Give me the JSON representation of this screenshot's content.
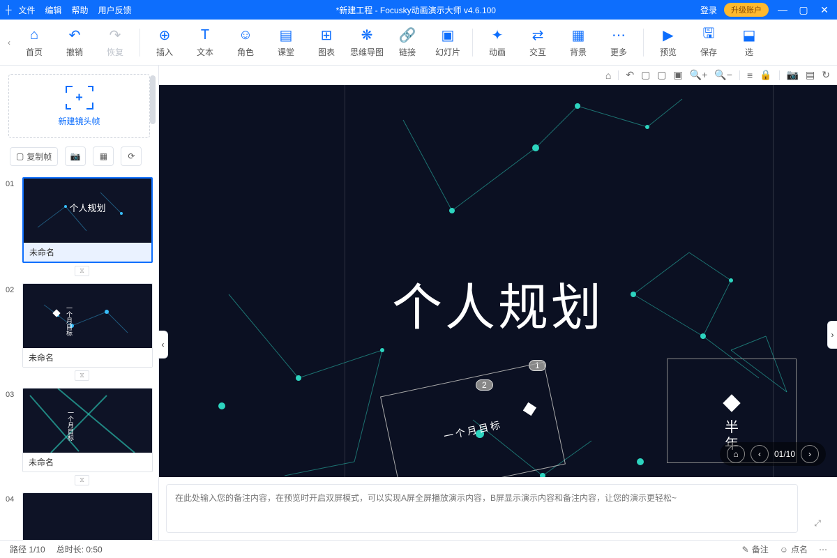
{
  "titlebar": {
    "menus": [
      "文件",
      "编辑",
      "帮助",
      "用户反馈"
    ],
    "title": "*新建工程 - Focusky动画演示大师  v4.6.100",
    "login": "登录",
    "upgrade": "升级账户"
  },
  "toolbar": {
    "items": [
      {
        "icon": "⌂",
        "label": "首页"
      },
      {
        "icon": "↶",
        "label": "撤销"
      },
      {
        "icon": "↷",
        "label": "恢复",
        "gray": true
      },
      {
        "sep": true
      },
      {
        "icon": "⊕",
        "label": "插入"
      },
      {
        "icon": "T",
        "label": "文本"
      },
      {
        "icon": "☺",
        "label": "角色"
      },
      {
        "icon": "▤",
        "label": "课堂"
      },
      {
        "icon": "⊞",
        "label": "图表"
      },
      {
        "icon": "❋",
        "label": "思维导图"
      },
      {
        "icon": "🔗",
        "label": "链接"
      },
      {
        "icon": "▣",
        "label": "幻灯片"
      },
      {
        "sep": true
      },
      {
        "icon": "✦",
        "label": "动画"
      },
      {
        "icon": "⇄",
        "label": "交互"
      },
      {
        "icon": "▦",
        "label": "背景"
      },
      {
        "icon": "⋯",
        "label": "更多"
      },
      {
        "sep": true
      },
      {
        "icon": "▶",
        "label": "预览"
      },
      {
        "icon": "🖫",
        "label": "保存"
      },
      {
        "icon": "⬓",
        "label": "选"
      }
    ]
  },
  "sidebar": {
    "newFrame": "新建镜头帧",
    "copyFrame": "复制帧",
    "slides": [
      {
        "num": "01",
        "name": "未命名",
        "title": "个人规划",
        "active": true
      },
      {
        "num": "02",
        "name": "未命名"
      },
      {
        "num": "03",
        "name": "未命名"
      },
      {
        "num": "04",
        "name": ""
      }
    ]
  },
  "minibar": {
    "icons": [
      "⌂",
      "|",
      "↶",
      "▢",
      "▢",
      "▣",
      "🔍+",
      "🔍−",
      "|",
      "≡",
      "🔒",
      "|",
      "📷",
      "▤",
      "↻"
    ]
  },
  "canvas": {
    "mainTitle": "个人规划",
    "badge1": "1",
    "badge2": "2",
    "frame2": "一个月目标",
    "frame3a": "半",
    "frame3b": "年",
    "nav": {
      "pos": "01/10"
    }
  },
  "notes": {
    "placeholder": "在此处输入您的备注内容，在预览时开启双屏模式，可以实现A屏全屏播放演示内容，B屏显示演示内容和备注内容，让您的演示更轻松~"
  },
  "status": {
    "path": "路径 1/10",
    "duration": "总时长: 0:50",
    "notes": "备注",
    "dots": "点名"
  }
}
